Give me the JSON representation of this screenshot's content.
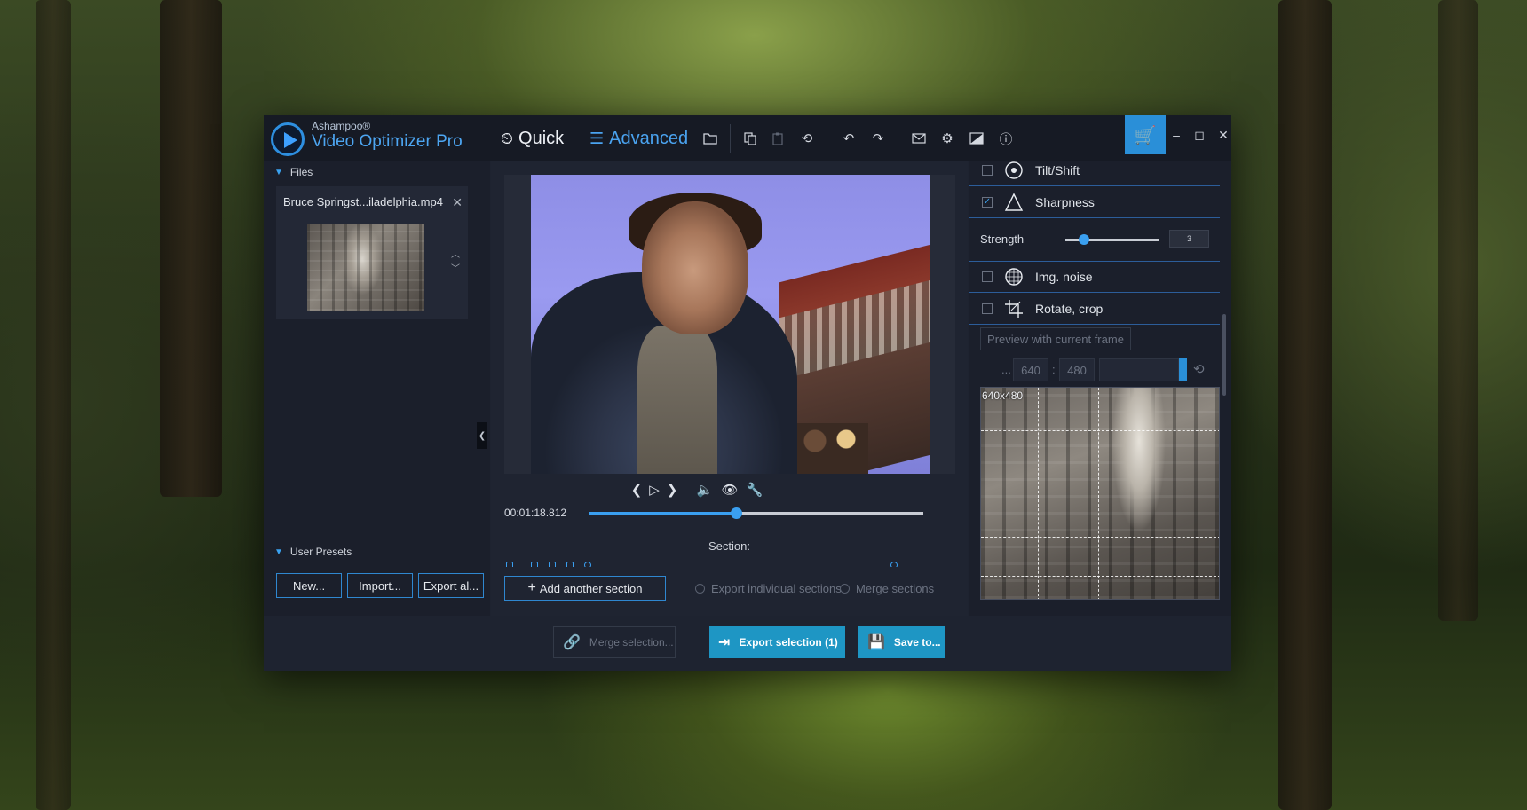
{
  "app": {
    "brand_small": "Ashampoo®",
    "brand_name": "Video Optimizer Pro",
    "mode_quick": "Quick",
    "mode_advanced": "Advanced",
    "accent_color": "#2a8fd8"
  },
  "toolbar": {
    "icons": [
      "folder-icon",
      "copy-icon",
      "paste-icon",
      "reset-icon",
      "undo-icon",
      "redo-icon",
      "mail-icon",
      "gear-icon",
      "image-icon",
      "info-icon",
      "cart-icon",
      "minimize-icon",
      "maximize-icon",
      "close-icon"
    ]
  },
  "files": {
    "header": "Files",
    "items": [
      {
        "name": "Bruce Springst...iladelphia.mp4"
      }
    ]
  },
  "presets": {
    "header": "User Presets",
    "new_label": "New...",
    "import_label": "Import...",
    "export_label": "Export al..."
  },
  "player": {
    "timecode": "00:01:18.812",
    "progress_fraction": 0.44,
    "section_label": "Section:",
    "add_section_label": "Add another section",
    "export_individual_label": "Export individual sections",
    "merge_sections_label": "Merge sections"
  },
  "filters": {
    "items": [
      {
        "label": "Tilt/Shift",
        "checked": false,
        "icon": "tilt-shift-icon"
      },
      {
        "label": "Sharpness",
        "checked": true,
        "icon": "sharpness-icon"
      },
      {
        "label": "Img. noise",
        "checked": false,
        "icon": "noise-icon"
      },
      {
        "label": "Rotate, crop",
        "checked": false,
        "icon": "crop-icon"
      }
    ],
    "strength_label": "Strength",
    "strength_value": "3",
    "strength_fraction": 0.2,
    "preview_label": "Preview with current frame",
    "ellipsis": "...",
    "width": "640",
    "height": "480",
    "separator": ":",
    "crop_size": "640x480"
  },
  "bottom": {
    "merge_label": "Merge selection...",
    "export_label": "Export selection (1)",
    "save_label": "Save to..."
  }
}
